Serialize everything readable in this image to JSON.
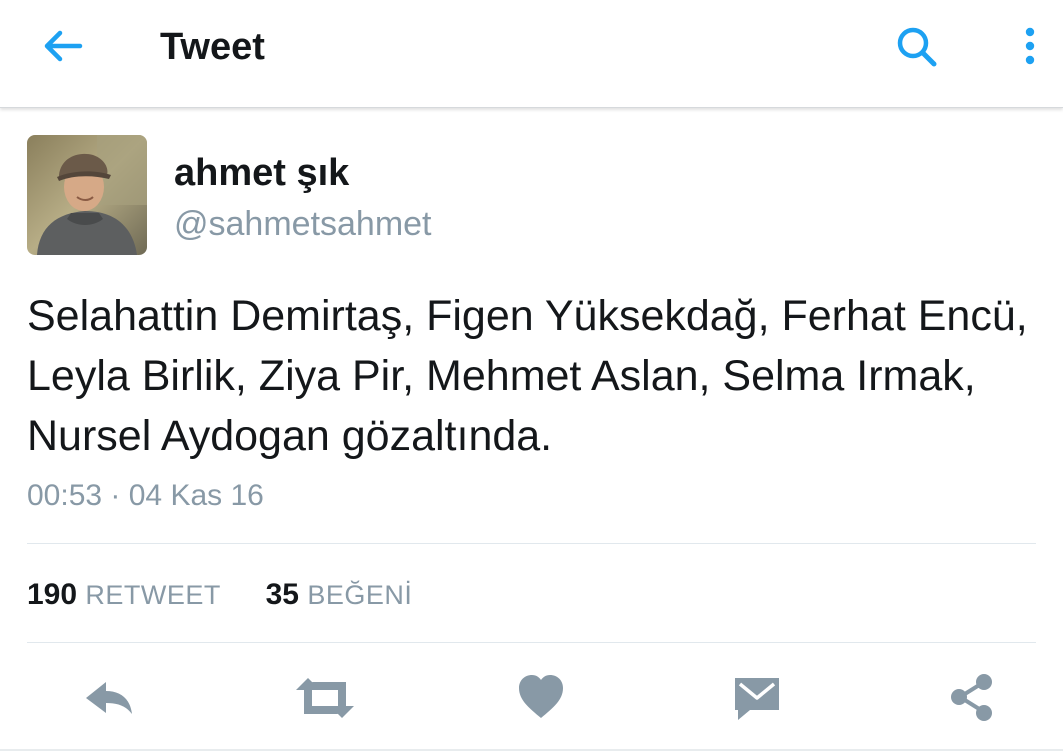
{
  "colors": {
    "accent": "#1da1f2",
    "text_primary": "#14171a",
    "text_secondary": "#8899a6",
    "action_icon": "#8899a6",
    "divider": "#e1e8ed"
  },
  "header": {
    "back_icon": "arrow-left-icon",
    "title": "Tweet",
    "search_icon": "search-icon",
    "more_icon": "vertical-dots-icon"
  },
  "tweet": {
    "author": {
      "name": "ahmet şık",
      "handle": "@sahmetsahmet",
      "avatar": "user-avatar-photo"
    },
    "text_lines": [
      "Selahattin Demirtaş, Figen Yüksekdağ, Ferhat Encü,",
      "Leyla Birlik, Ziya Pir, Mehmet Aslan, Selma Irmak,",
      "Nursel Aydogan gözaltında."
    ],
    "timestamp": "00:53 · 04 Kas 16",
    "stats": {
      "retweet_count": "190",
      "retweet_label": "RETWEET",
      "like_count": "35",
      "like_label": "BEĞENİ"
    }
  },
  "actions": [
    {
      "name": "reply",
      "icon": "reply-icon"
    },
    {
      "name": "retweet",
      "icon": "retweet-icon"
    },
    {
      "name": "like",
      "icon": "heart-icon"
    },
    {
      "name": "direct-message",
      "icon": "envelope-icon"
    },
    {
      "name": "share",
      "icon": "share-icon"
    }
  ]
}
